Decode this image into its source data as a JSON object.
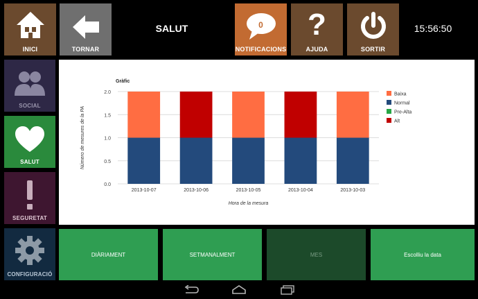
{
  "header": {
    "title": "SALUT",
    "clock": "15:56:50",
    "home_label": "INICI",
    "back_label": "TORNAR",
    "notifications_label": "NOTIFICACIONS",
    "notifications_count": "0",
    "help_label": "AJUDA",
    "exit_label": "SORTIR"
  },
  "sidebar": {
    "items": [
      {
        "label": "SOCIAL"
      },
      {
        "label": "SALUT"
      },
      {
        "label": "SEGURETAT"
      },
      {
        "label": "CONFIGURACIÓ"
      }
    ]
  },
  "chart_data": {
    "type": "bar",
    "stacked": true,
    "title": "Gràfic",
    "xlabel": "Hora de la mesura",
    "ylabel": "Número de mesures de la PA",
    "categories": [
      "2013-10-07",
      "2013-10-06",
      "2013-10-05",
      "2013-10-04",
      "2013-10-03"
    ],
    "ylim": [
      0,
      2
    ],
    "yticks": [
      "0.0",
      "0.5",
      "1.0",
      "1.5",
      "2.0"
    ],
    "legend_position": "right",
    "series": [
      {
        "name": "Baixa",
        "color": "#ff6d42",
        "values": [
          1,
          0,
          1,
          0,
          1
        ]
      },
      {
        "name": "Normal",
        "color": "#234a7c",
        "values": [
          1,
          1,
          1,
          1,
          1
        ]
      },
      {
        "name": "Pre-Alta",
        "color": "#27a645",
        "values": [
          0,
          0,
          0,
          0,
          0
        ]
      },
      {
        "name": "Alt",
        "color": "#c00000",
        "values": [
          0,
          1,
          0,
          1,
          0
        ]
      }
    ],
    "stack_order": [
      "Normal",
      "Alt",
      "Pre-Alta",
      "Baixa"
    ]
  },
  "bottom_tabs": [
    {
      "label": "DIÀRIAMENT",
      "active": true
    },
    {
      "label": "SETMANALMENT",
      "active": true
    },
    {
      "label": "MES",
      "active": false
    },
    {
      "label": "Escolliu la data",
      "active": true
    }
  ]
}
